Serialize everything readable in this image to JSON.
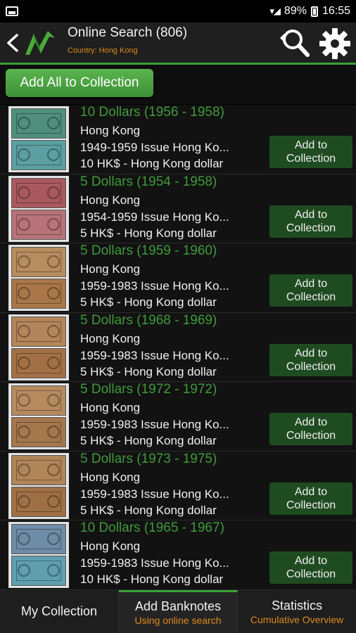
{
  "status_bar": {
    "battery": "89%",
    "time": "16:55"
  },
  "toolbar": {
    "title": "Online Search (806)",
    "subtitle": "Country: Hong Kong"
  },
  "actions": {
    "add_all_label": "Add All to Collection"
  },
  "items": [
    {
      "title": "10 Dollars (1956 - 1958)",
      "country": "Hong Kong",
      "issue": "1949-1959 Issue Hong Ko...",
      "denomination": "10 HK$ - Hong Kong dollar",
      "button": "Add to Collection",
      "colors": [
        "#4f8f7c",
        "#5c9fa0"
      ]
    },
    {
      "title": "5 Dollars (1954 - 1958)",
      "country": "Hong Kong",
      "issue": "1954-1959 Issue Hong Ko...",
      "denomination": "5 HK$ - Hong Kong dollar",
      "button": "Add to Collection",
      "colors": [
        "#a9595e",
        "#b7727a"
      ]
    },
    {
      "title": "5 Dollars (1959 - 1960)",
      "country": "Hong Kong",
      "issue": "1959-1983 Issue Hong Ko...",
      "denomination": "5 HK$ - Hong Kong dollar",
      "button": "Add to Collection",
      "colors": [
        "#b78c5e",
        "#a97648"
      ]
    },
    {
      "title": "5 Dollars (1968 - 1969)",
      "country": "Hong Kong",
      "issue": "1959-1983 Issue Hong Ko...",
      "denomination": "5 HK$ - Hong Kong dollar",
      "button": "Add to Collection",
      "colors": [
        "#b4855a",
        "#a37046"
      ]
    },
    {
      "title": "5 Dollars (1972 - 1972)",
      "country": "Hong Kong",
      "issue": "1959-1983 Issue Hong Ko...",
      "denomination": "5 HK$ - Hong Kong dollar",
      "button": "Add to Collection",
      "colors": [
        "#b58a5f",
        "#a4774d"
      ]
    },
    {
      "title": "5 Dollars (1973 - 1975)",
      "country": "Hong Kong",
      "issue": "1959-1983 Issue Hong Ko...",
      "denomination": "5 HK$ - Hong Kong dollar",
      "button": "Add to Collection",
      "colors": [
        "#b08558",
        "#a07045"
      ]
    },
    {
      "title": "10 Dollars (1965 - 1967)",
      "country": "Hong Kong",
      "issue": "1959-1983 Issue Hong Ko...",
      "denomination": "10 HK$ - Hong Kong dollar",
      "button": "Add to Collection",
      "colors": [
        "#6e8ca6",
        "#5f9fb0"
      ]
    }
  ],
  "bottom_nav": [
    {
      "label": "My Collection",
      "sub": ""
    },
    {
      "label": "Add Banknotes",
      "sub": "Using online search"
    },
    {
      "label": "Statistics",
      "sub": "Cumulative Overview"
    }
  ],
  "colors": {
    "accent_green": "#3aa236",
    "title_green": "#3f9a3a",
    "subtitle_orange": "#e08a1e",
    "button_green": "#1f4b20"
  }
}
